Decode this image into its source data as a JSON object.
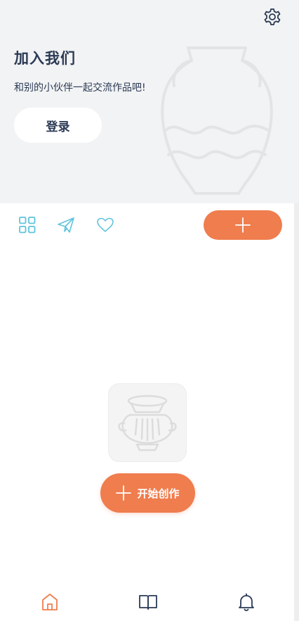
{
  "header": {
    "title": "加入我们",
    "subtitle": "和别的小伙伴一起交流作品吧!",
    "login_label": "登录"
  },
  "tabs": [
    {
      "icon": "grid-icon"
    },
    {
      "icon": "paper-plane-icon"
    },
    {
      "icon": "heart-icon"
    }
  ],
  "empty_state": {
    "start_label": "开始创作"
  },
  "bottom_nav": [
    {
      "icon": "home-icon",
      "active": true
    },
    {
      "icon": "book-icon",
      "active": false
    },
    {
      "icon": "bell-icon",
      "active": false
    }
  ],
  "colors": {
    "accent": "#ef7d4e",
    "tab_icon": "#5fc3dc",
    "text_dark": "#2b3a55",
    "header_bg": "#f2f3f4"
  }
}
